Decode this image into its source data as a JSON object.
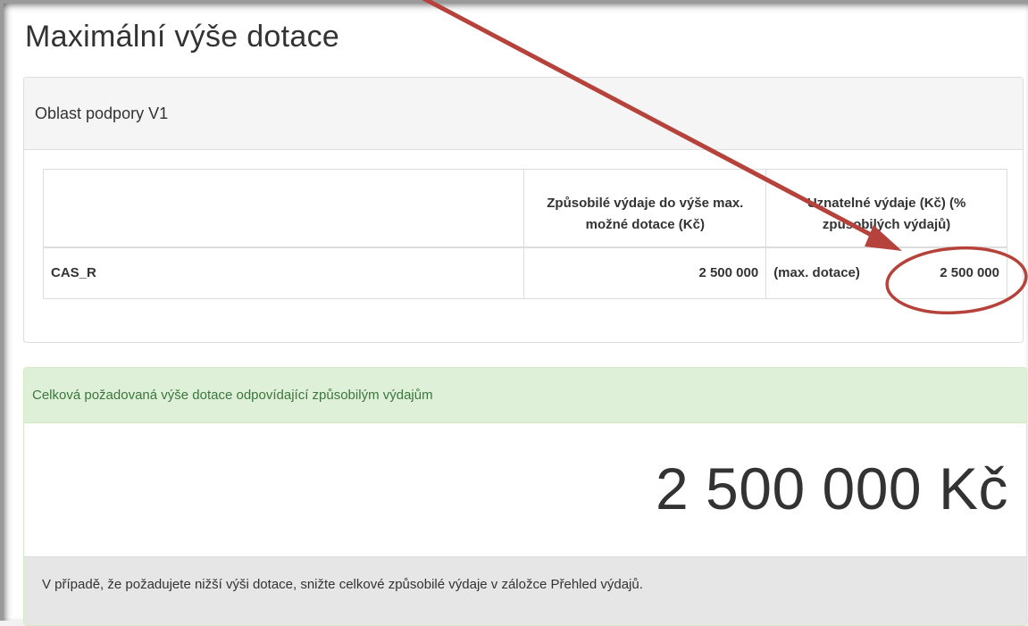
{
  "page": {
    "title": "Maximální výše dotace"
  },
  "support_area": {
    "heading": "Oblast podpory V1",
    "table": {
      "headers": [
        "",
        "Způsobilé výdaje do výše max. možné dotace (Kč)",
        "Uznatelné výdaje (Kč) (% způsobilých výdajů)"
      ],
      "rows": [
        {
          "name": "CAS_R",
          "eligible": "2 500 000",
          "note": "(max. dotace)",
          "recognized": "2 500 000"
        }
      ]
    }
  },
  "total": {
    "heading": "Celková požadovaná výše dotace odpovídající způsobilým výdajům",
    "amount": "2 500 000 Kč",
    "footer": "V případě, že požadujete nižší výši dotace, snižte celkové způsobilé výdaje v záložce Přehled výdajů."
  },
  "colors": {
    "annotation": "#b5423b",
    "success_bg": "#dff0d8",
    "success_text": "#3c763d"
  }
}
